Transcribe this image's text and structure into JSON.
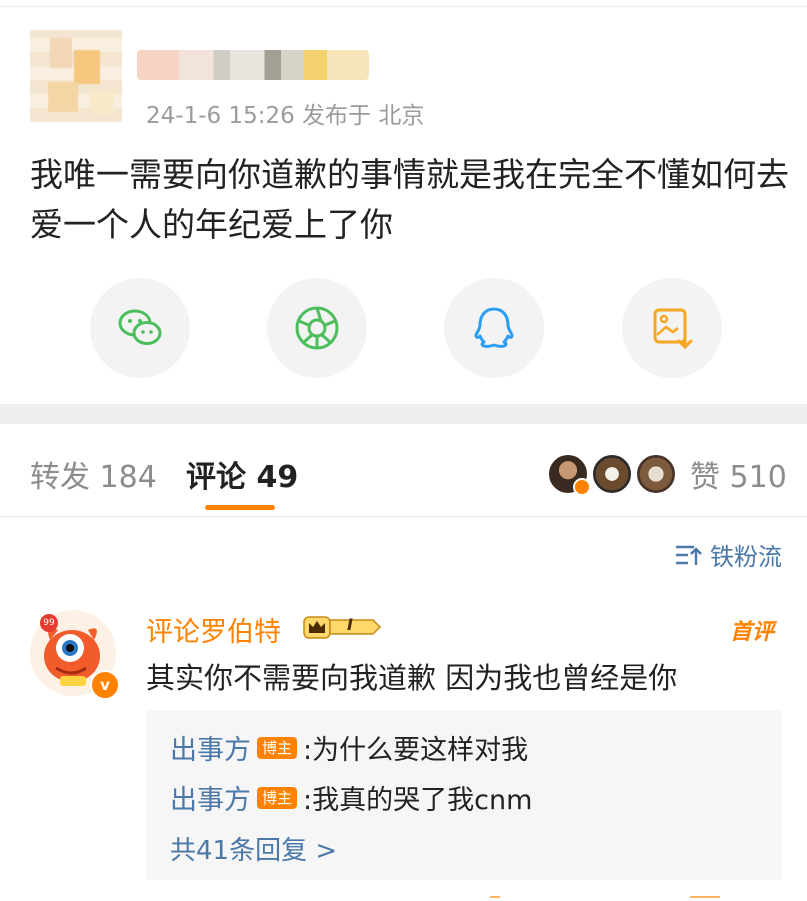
{
  "post": {
    "meta": "24-1-6 15:26  发布于 北京",
    "text": "我唯一需要向你道歉的事情就是我在完全不懂如何去爱一个人的年纪爱上了你"
  },
  "share": {
    "items": [
      "wechat-icon",
      "moments-icon",
      "qq-icon",
      "save-image-icon"
    ]
  },
  "tabs": {
    "repost": "转发 184",
    "comment": "评论 49",
    "likes": "赞 510"
  },
  "sort": {
    "label": "铁粉流"
  },
  "comment": {
    "author": "评论罗伯特",
    "avatar_badge": "99",
    "verified_mark": "v",
    "fan_level": "I",
    "first_label": "首评",
    "text": "其实你不需要向我道歉 因为我也曾经是你",
    "replies": [
      {
        "name": "出事方",
        "tag": "博主",
        "text": ":为什么要这样对我"
      },
      {
        "name": "出事方",
        "tag": "博主",
        "text": ":我真的哭了我cnm"
      }
    ],
    "more": "共41条回复 >"
  },
  "colors": {
    "accent": "#ff8200",
    "link": "#4a78a8"
  }
}
